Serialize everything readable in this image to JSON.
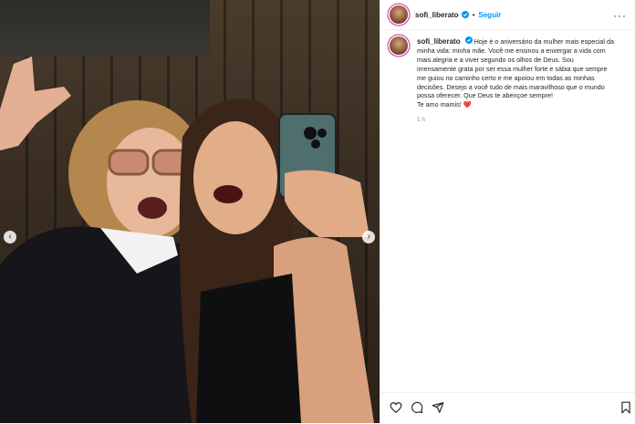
{
  "post": {
    "username": "sofi_liberato",
    "follow_label": "Seguir",
    "more_label": "···",
    "caption_lines": [
      "Hoje é o aniversário da mulher mais especial da",
      "minha vida: minha mãe. Você me ensinou a enxergar a vida com",
      "mais alegria e a viver segundo os olhos de Deus. Sou",
      "imensamente grata por ser essa mulher forte e sábia que sempre",
      "me guiou no caminho certo e me apoiou em todas as minhas",
      "decisões. Desejo a você tudo de mais maravilhoso que o mundo",
      "possa oferecer. Que Deus te abençoe sempre!",
      "Te amo mamis! ❤️"
    ],
    "time_ago": "1 h"
  },
  "carousel": {
    "prev_label": "‹",
    "next_label": "›"
  },
  "icons": {
    "like": "heart-icon",
    "comment": "comment-icon",
    "share": "share-icon",
    "save": "bookmark-icon",
    "verified": "verified-badge-icon"
  },
  "colors": {
    "link": "#0095f6",
    "verified": "#0095f6",
    "text": "#262626",
    "heart": "#ed4956"
  }
}
